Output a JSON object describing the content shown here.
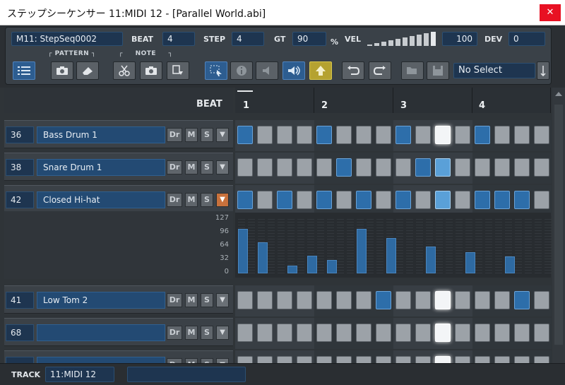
{
  "window": {
    "title": "ステップシーケンサー  11:MIDI 12 - [Parallel World.abi]",
    "close_glyph": "✕"
  },
  "toolbar": {
    "seq_name": "M11: StepSeq0002",
    "beat_label": "BEAT",
    "beat_value": "4",
    "step_label": "STEP",
    "step_value": "4",
    "gt_label": "GT",
    "gt_value": "90",
    "gt_unit": "%",
    "vel_label": "VEL",
    "vel_value": "100",
    "dev_label": "DEV",
    "dev_value": "0",
    "pattern_group": "PATTERN",
    "note_group": "NOTE",
    "select_value": "No Select",
    "icons": [
      "list-icon",
      "pattern-capture-icon",
      "eraser-icon",
      "scissors-icon",
      "note-capture-icon",
      "paste-icon",
      "select-tool-icon",
      "info-icon",
      "speaker-mute-icon",
      "speaker-play-icon",
      "arrow-up-icon",
      "undo-icon",
      "redo-icon",
      "folder-open-icon",
      "save-icon",
      "sort-icon"
    ]
  },
  "grid": {
    "beat_label": "BEAT",
    "beats": [
      "1",
      "2",
      "3",
      "4"
    ],
    "tracks": [
      {
        "note": "36",
        "name": "Bass Drum 1",
        "dr": "Dr",
        "m": "M",
        "s": "S",
        "steps": [
          1,
          0,
          0,
          0,
          1,
          0,
          0,
          0,
          1,
          0,
          3,
          0,
          1,
          0,
          0,
          0
        ]
      },
      {
        "note": "38",
        "name": "Snare Drum 1",
        "dr": "Dr",
        "m": "M",
        "s": "S",
        "steps": [
          0,
          0,
          0,
          0,
          0,
          1,
          0,
          0,
          0,
          1,
          2,
          0,
          0,
          0,
          0,
          0
        ]
      },
      {
        "note": "42",
        "name": "Closed Hi-hat",
        "dr": "Dr",
        "m": "M",
        "s": "S",
        "steps": [
          1,
          0,
          1,
          0,
          1,
          0,
          1,
          0,
          1,
          0,
          2,
          0,
          1,
          1,
          1,
          0
        ]
      },
      {
        "note": "41",
        "name": "Low Tom 2",
        "dr": "Dr",
        "m": "M",
        "s": "S",
        "steps": [
          0,
          0,
          0,
          0,
          0,
          0,
          0,
          1,
          0,
          0,
          3,
          0,
          0,
          0,
          1,
          0
        ]
      },
      {
        "note": "68",
        "name": "",
        "dr": "Dr",
        "m": "M",
        "s": "S",
        "steps": [
          0,
          0,
          0,
          0,
          0,
          0,
          0,
          0,
          0,
          0,
          3,
          0,
          0,
          0,
          0,
          0
        ]
      },
      {
        "note": "",
        "name": "",
        "dr": "Dr",
        "m": "M",
        "s": "S",
        "steps": [
          0,
          0,
          0,
          0,
          0,
          0,
          0,
          0,
          0,
          0,
          3,
          0,
          0,
          0,
          0,
          0
        ]
      }
    ],
    "velocity_ticks": [
      "127",
      "96",
      "64",
      "32",
      "0"
    ],
    "velocity_values": [
      100,
      0,
      70,
      0,
      0,
      18,
      0,
      40,
      0,
      30,
      0,
      0,
      100,
      0,
      0,
      80,
      0,
      0,
      0,
      60,
      0,
      0,
      0,
      48,
      0,
      0,
      0,
      38,
      0,
      0,
      0,
      0
    ]
  },
  "footer": {
    "track_label": "TRACK",
    "track_value": "11:MIDI 12",
    "extra_value": ""
  },
  "colors": {
    "accent": "#2d6eaa",
    "highlight": "#5aa0d8",
    "active_dropdown": "#c8713c",
    "close": "#e81123"
  }
}
